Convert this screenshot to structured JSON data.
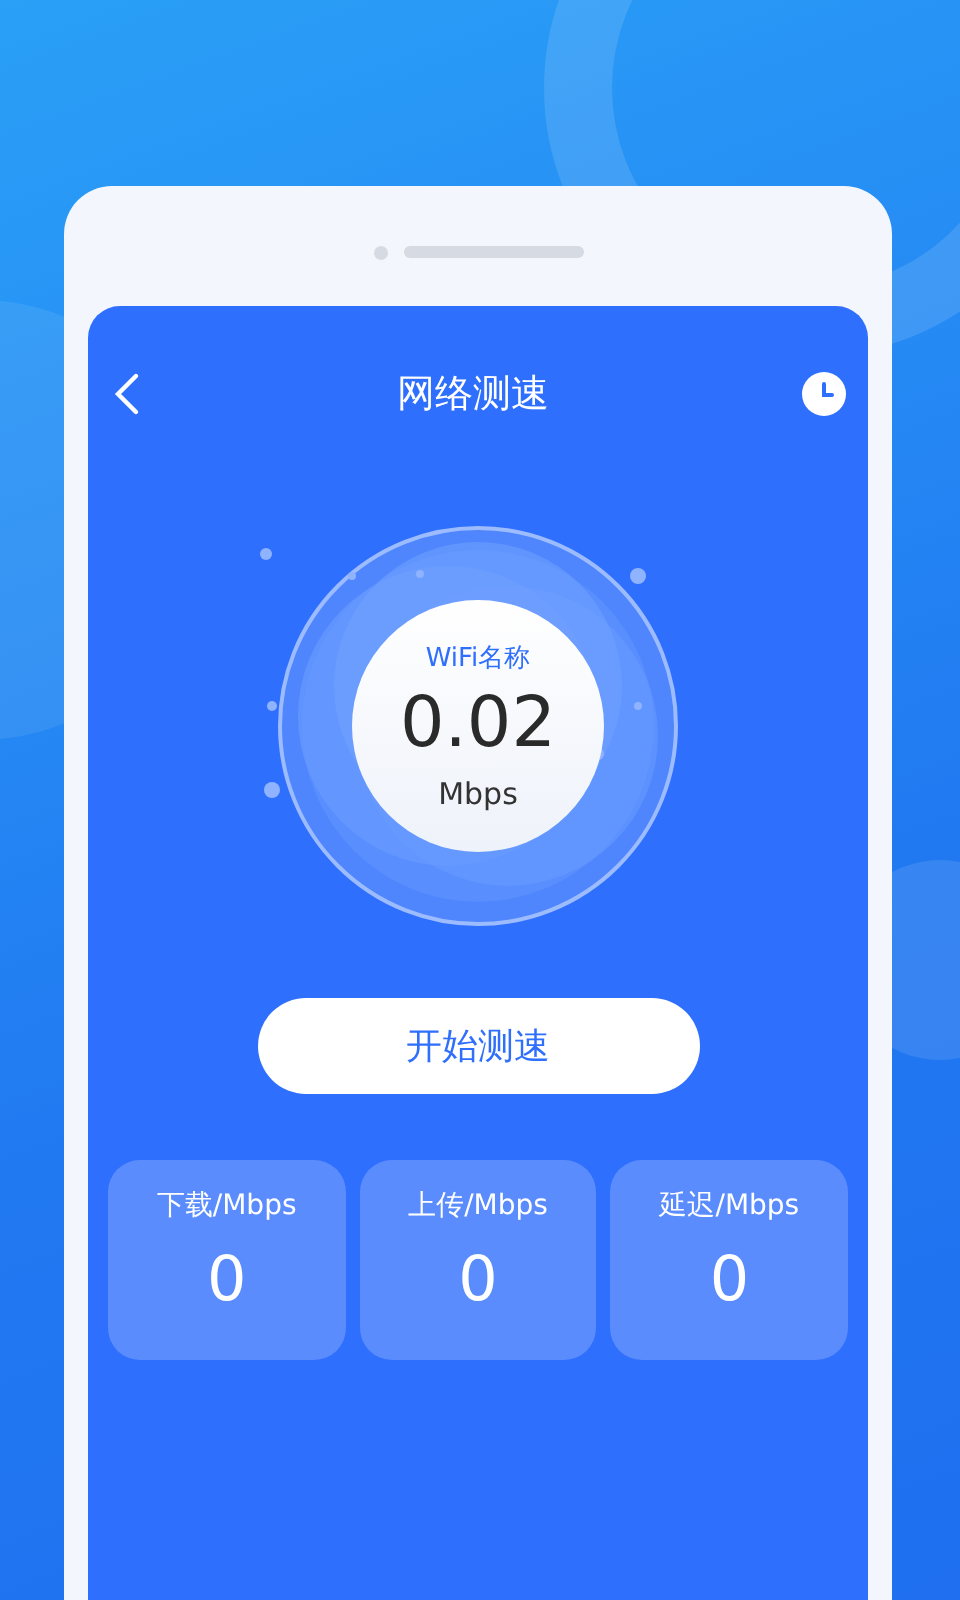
{
  "header": {
    "title": "网络测速"
  },
  "gauge": {
    "network_label": "WiFi名称",
    "speed": "0.02",
    "unit": "Mbps"
  },
  "start_button": {
    "label": "开始测速"
  },
  "stats": [
    {
      "label": "下载/Mbps",
      "value": "0"
    },
    {
      "label": "上传/Mbps",
      "value": "0"
    },
    {
      "label": "延迟/Mbps",
      "value": "0"
    }
  ]
}
